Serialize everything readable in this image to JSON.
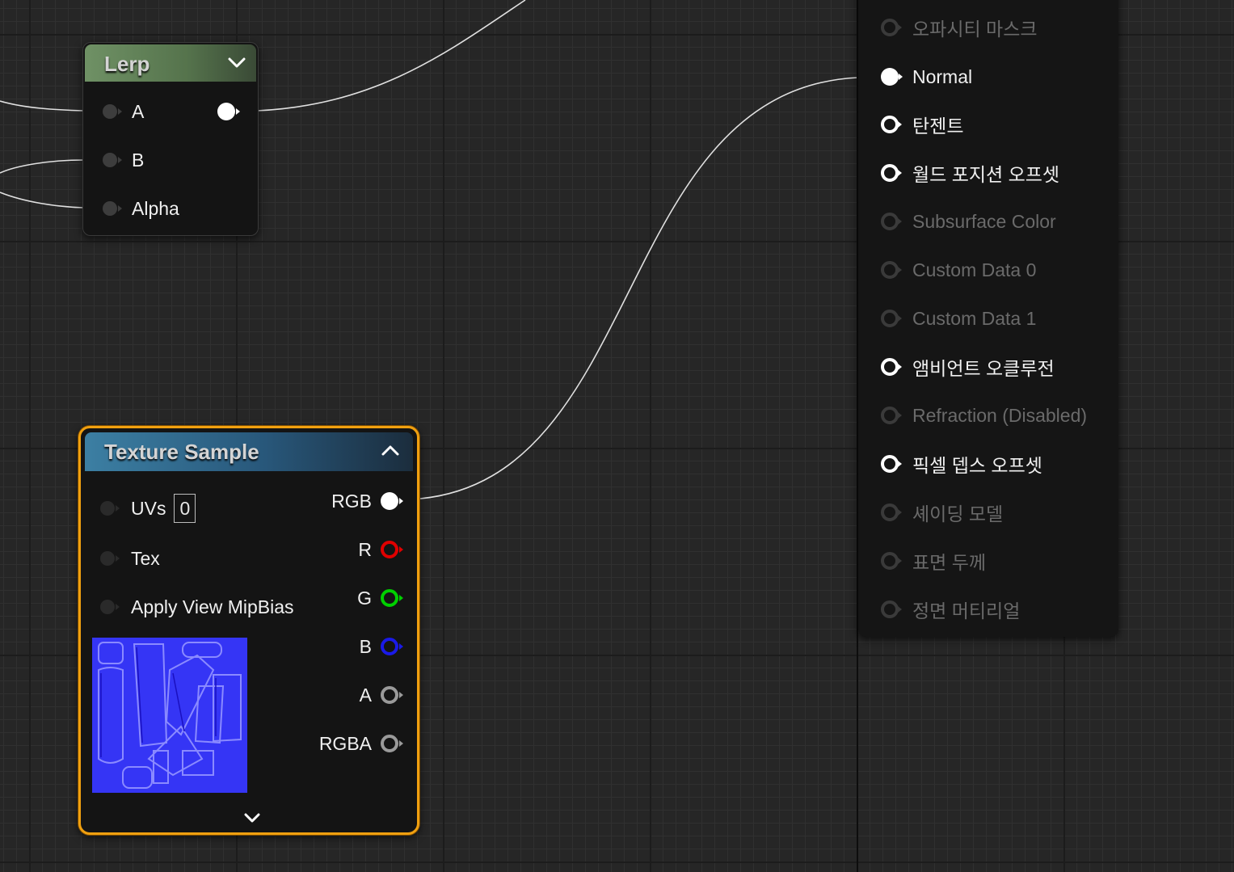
{
  "lerp_node": {
    "title": "Lerp",
    "inputs": [
      {
        "label": "A"
      },
      {
        "label": "B"
      },
      {
        "label": "Alpha"
      }
    ]
  },
  "texture_node": {
    "title": "Texture Sample",
    "uvs_value": "0",
    "inputs": [
      {
        "label": "UVs"
      },
      {
        "label": "Tex"
      },
      {
        "label": "Apply View MipBias"
      }
    ],
    "outputs": [
      {
        "label": "RGB",
        "color": "#ffffff"
      },
      {
        "label": "R",
        "color": "#e00000"
      },
      {
        "label": "G",
        "color": "#00d000"
      },
      {
        "label": "B",
        "color": "#1a1ae8"
      },
      {
        "label": "A",
        "color": "#9a9a9a"
      },
      {
        "label": "RGBA",
        "color": "#9a9a9a"
      }
    ],
    "preview_color": "#3535f5"
  },
  "result_node": {
    "pins": [
      {
        "label": "오파시티 마스크",
        "enabled": false
      },
      {
        "label": "Normal",
        "enabled": true,
        "connected": true
      },
      {
        "label": "탄젠트",
        "enabled": true
      },
      {
        "label": "월드 포지션 오프셋",
        "enabled": true
      },
      {
        "label": "Subsurface Color",
        "enabled": false
      },
      {
        "label": "Custom Data 0",
        "enabled": false
      },
      {
        "label": "Custom Data 1",
        "enabled": false
      },
      {
        "label": "앰비언트 오클루전",
        "enabled": true
      },
      {
        "label": "Refraction (Disabled)",
        "enabled": false
      },
      {
        "label": "픽셀 뎁스 오프셋",
        "enabled": true
      },
      {
        "label": "셰이딩 모델",
        "enabled": false
      },
      {
        "label": "표면 두께",
        "enabled": false
      },
      {
        "label": "정면 머티리얼",
        "enabled": false
      }
    ]
  },
  "colors": {
    "graph_bg": "#262626",
    "lerp_header": "#5b7b51",
    "texture_header": "#2f6a8a",
    "selection_outline": "#f0a010",
    "wire": "#e0e0e0"
  }
}
